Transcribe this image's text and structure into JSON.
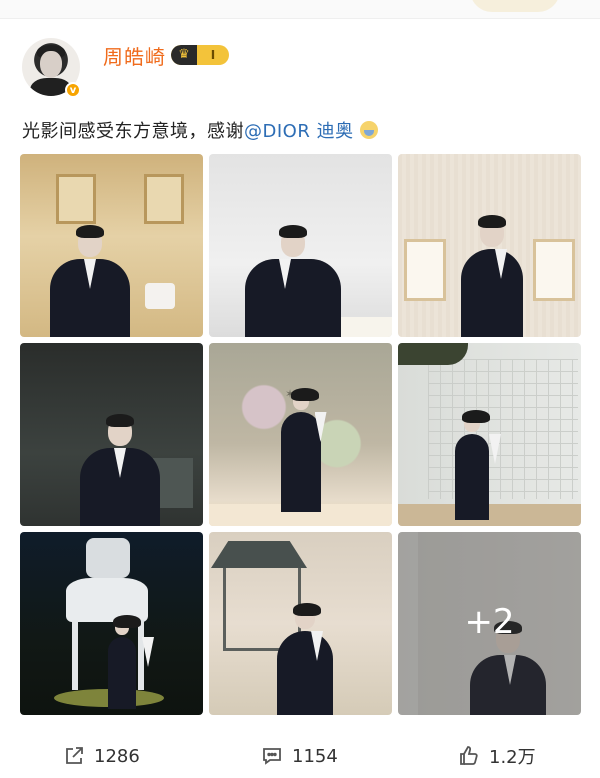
{
  "post": {
    "author": "周皓崎",
    "vip_level": "I",
    "text_prefix": "光影间感受东方意境，感谢",
    "mention": "@DIOR 迪奥"
  },
  "gallery": {
    "visible_count": 9,
    "more_label": "+2"
  },
  "actions": {
    "repost_count": "1286",
    "comment_count": "1154",
    "like_count": "1.2万"
  },
  "colors": {
    "username": "#f06b1c",
    "mention": "#2d6db5",
    "verified_badge": "#f7a400",
    "vip_badge": "#f3c33a"
  }
}
